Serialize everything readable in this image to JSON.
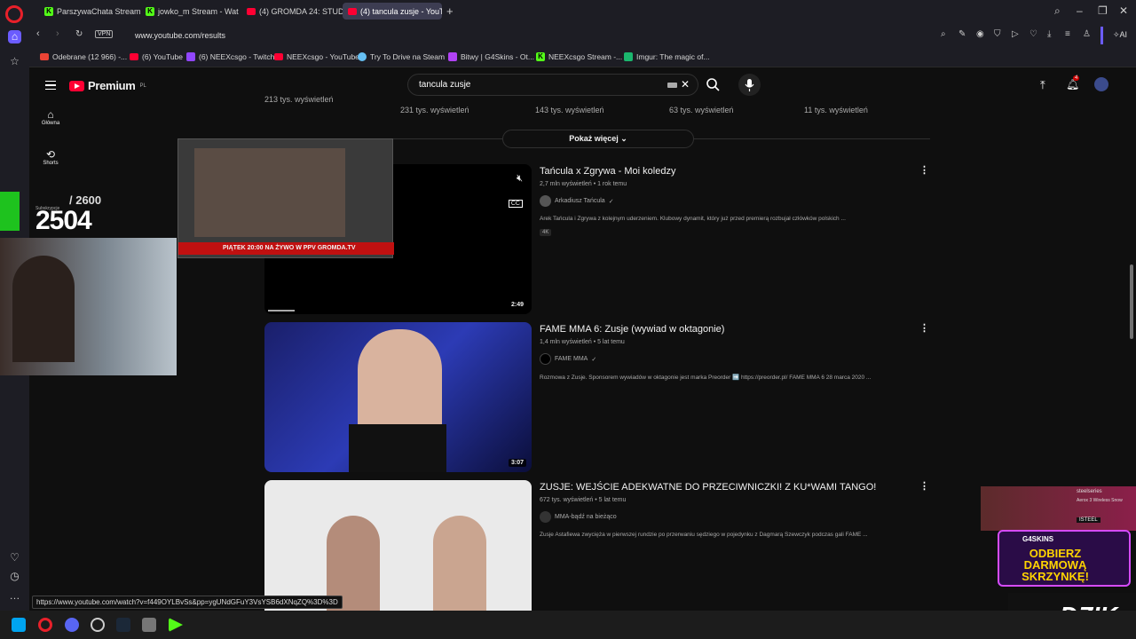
{
  "browser": {
    "tabs": [
      {
        "label": "ParszywaChata Stream",
        "icon": "kick"
      },
      {
        "label": "jowko_m Stream - Wat",
        "icon": "kick"
      },
      {
        "label": "(4) GROMDA 24: STUD",
        "icon": "youtube"
      },
      {
        "label": "(4) tancula zusje - YouTub",
        "icon": "youtube"
      }
    ],
    "url": "www.youtube.com/results",
    "vpn_label": "VPN",
    "ai_label": "AI",
    "bookmarks": [
      {
        "label": "Odebrane (12 966) -...",
        "icon": "gmail"
      },
      {
        "label": "(6) YouTube",
        "icon": "youtube"
      },
      {
        "label": "(6) NEEXcsgo - Twitch",
        "icon": "twitch"
      },
      {
        "label": "NEEXcsgo - YouTube",
        "icon": "youtube"
      },
      {
        "label": "Try To Drive na Steam",
        "icon": "steam"
      },
      {
        "label": "Bitwy | G4Skins - Ot...",
        "icon": "g4skins"
      },
      {
        "label": "NEEXcsgo Stream -...",
        "icon": "kick"
      },
      {
        "label": "Imgur: The magic of...",
        "icon": "imgur"
      }
    ],
    "status_url": "https://www.youtube.com/watch?v=f449OYLBvSs&pp=ygUNdGFuY3VsYSB6dXNqZQ%3D%3D"
  },
  "youtube": {
    "logo_text": "Premium",
    "logo_region": "PL",
    "search_query": "tancula zusje",
    "notifications_count": "4",
    "nav": [
      {
        "label": "Główna",
        "icon": "home-icon"
      },
      {
        "label": "Shorts",
        "icon": "shorts-icon"
      }
    ],
    "previous_row_views": [
      "213 tys. wyświetleń",
      "231 tys. wyświetleń",
      "143 tys. wyświetleń",
      "63 tys. wyświetleń",
      "11 tys. wyświetleń"
    ],
    "show_more_label": "Pokaż więcej",
    "videos": [
      {
        "title": "Tańcula x Zgrywa - Moi koledzy",
        "meta": "2,7 mln wyświetleń • 1 rok temu",
        "channel": "Arkadiusz Tańcula",
        "verified": true,
        "description": "Arek Tańcula i Zgrywa z kolejnym uderzeniem. Klubowy dynamit, który już przed premierą rozbujał człówków polskich ...",
        "badge": "4K",
        "duration": "2:49"
      },
      {
        "title": "FAME MMA 6: Zusje (wywiad w oktagonie)",
        "meta": "1,4 mln wyświetleń • 5 lat temu",
        "channel": "FAME MMA",
        "verified": true,
        "description": "Rozmowa z Zusje. Sponsorem wywiadów w oktagonie jest marka Preorder ➡️ https://preorder.pl/ FAME MMA 6 28 marca 2020 ...",
        "duration": "3:07"
      },
      {
        "title": "ZUSJE: WEJŚCIE ADEKWATNE DO PRZECIWNICZKI! Z KU*WAMI TANGO!",
        "meta": "672 tys. wyświetleń • 5 lat temu",
        "channel": "MMA-bądź na bieżąco",
        "verified": false,
        "description": "Zusje Astafiewa zwycięża w pierwszej rundzie po przerwaniu sędziego w pojedynku z Dagmarą Szewczyk podczas gali FAME ..."
      }
    ]
  },
  "stream_overlay": {
    "sub_label": "Subskrypcje",
    "sub_count": "2504",
    "sub_goal": "/ 2600",
    "stream_banner": "PIĄTEK 20:00 NA ŻYWO W PPV",
    "stream_site": "GROMDA.TV",
    "promo_brand": "G4SKINS",
    "promo_text": "ODBIERZ DARMOWĄ SKRZYNKĘ!",
    "sponsor_product": "Aerox 3 Wireless Snow",
    "sponsor_brand": "steelseries",
    "sponsor_shop": "ISTEEL",
    "dzik_text": "DZIK"
  }
}
